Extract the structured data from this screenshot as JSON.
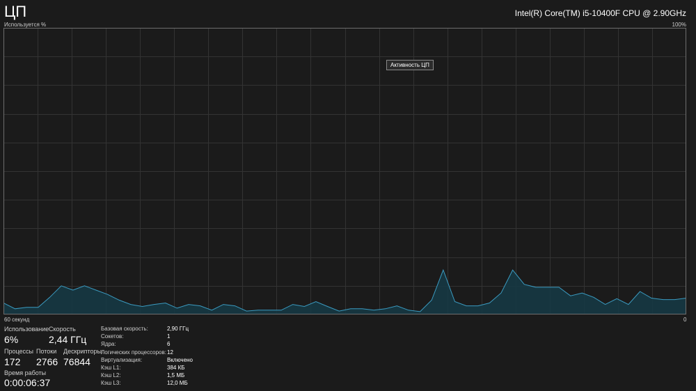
{
  "header": {
    "title": "ЦП",
    "cpu_name": "Intel(R) Core(TM) i5-10400F CPU @ 2.90GHz"
  },
  "graph": {
    "ylabel": "Используется %",
    "ymax_label": "100%",
    "xlabel_left": "60 секунд",
    "xlabel_right": "0",
    "tooltip": "Активность ЦП",
    "line_color": "#3b9bc1",
    "fill_color": "#163844",
    "grid_color": "#333333"
  },
  "chart_data": {
    "type": "area",
    "x_range": [
      60,
      0
    ],
    "ylim": [
      0,
      100
    ],
    "grid": true,
    "values": [
      4,
      2,
      2.5,
      2.5,
      6,
      10,
      8.5,
      10,
      8.5,
      7,
      5,
      3.5,
      2.8,
      3.5,
      4,
      2.2,
      3.5,
      3,
      1.5,
      3.5,
      3,
      1.2,
      1.5,
      1.5,
      1.5,
      3.5,
      2.8,
      4.5,
      2.8,
      1.2,
      2,
      2,
      1.5,
      2,
      3,
      1.5,
      1,
      5,
      15.5,
      4.5,
      3,
      3,
      4,
      7.5,
      15.5,
      10.5,
      9.5,
      9.5,
      9.5,
      6.5,
      7.5,
      6,
      3.5,
      5.5,
      3.5,
      8,
      5.7,
      5.2,
      5.2,
      5.7
    ]
  },
  "stats": {
    "usage": {
      "label": "Использование",
      "value": "6%"
    },
    "speed": {
      "label": "Скорость",
      "value": "2,44 ГГц"
    },
    "processes": {
      "label": "Процессы",
      "value": "172"
    },
    "threads": {
      "label": "Потоки",
      "value": "2766"
    },
    "handles": {
      "label": "Дескрипторы",
      "value": "76844"
    },
    "uptime": {
      "label": "Время работы",
      "value": "0:00:06:37"
    }
  },
  "specs": [
    {
      "key": "Базовая скорость:",
      "value": "2,90 ГГц"
    },
    {
      "key": "Сокетов:",
      "value": "1"
    },
    {
      "key": "Ядра:",
      "value": "6"
    },
    {
      "key": "Логических процессоров:",
      "value": "12"
    },
    {
      "key": "Виртуализация:",
      "value": "Включено"
    },
    {
      "key": "Кэш L1:",
      "value": "384 КБ"
    },
    {
      "key": "Кэш L2:",
      "value": "1,5 МБ"
    },
    {
      "key": "Кэш L3:",
      "value": "12,0 МБ"
    }
  ]
}
